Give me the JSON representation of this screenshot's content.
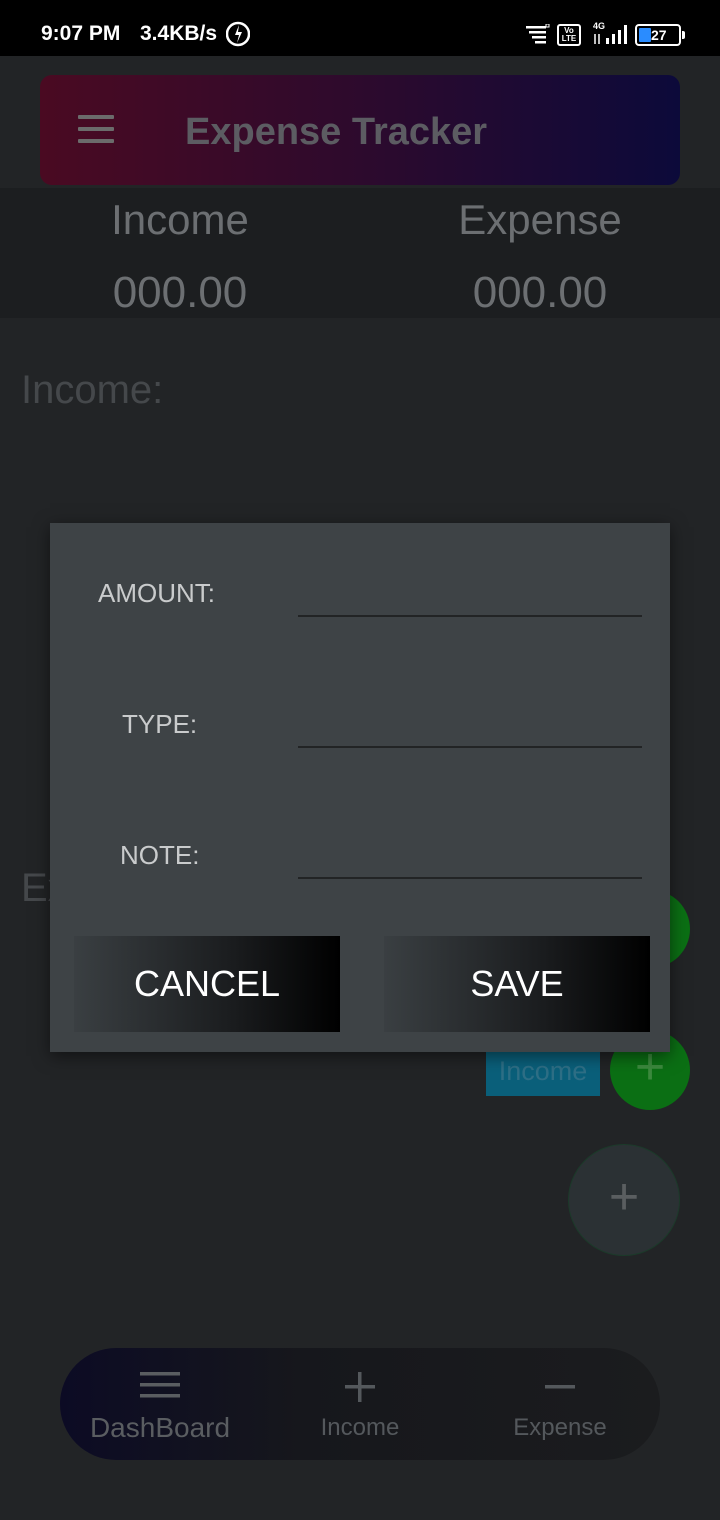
{
  "status_bar": {
    "time": "9:07 PM",
    "speed": "3.4KB/s",
    "volte": "Vo LTE",
    "network": "4G",
    "battery": "27"
  },
  "app_bar": {
    "title": "Expense Tracker"
  },
  "summary": {
    "income_label": "Income",
    "income_value": "000.00",
    "expense_label": "Expense",
    "expense_value": "000.00"
  },
  "sections": {
    "income": "Income:",
    "expense": "Ex"
  },
  "fabs": {
    "income_label": "Income",
    "plus": "+"
  },
  "dialog": {
    "amount_label": "AMOUNT:",
    "type_label": "TYPE:",
    "note_label": "NOTE:",
    "amount_value": "",
    "type_value": "",
    "note_value": "",
    "cancel_label": "CANCEL",
    "save_label": "SAVE"
  },
  "bottom_nav": {
    "items": [
      {
        "label": "DashBoard",
        "icon": "menu-icon"
      },
      {
        "label": "Income",
        "icon": "plus-icon"
      },
      {
        "label": "Expense",
        "icon": "minus-icon"
      }
    ]
  },
  "colors": {
    "background": "#222426",
    "dialog": "#3e4346",
    "fab_green": "#0b6f14",
    "income_chip": "#0a5f7a",
    "battery_fill": "#2a8cff"
  }
}
